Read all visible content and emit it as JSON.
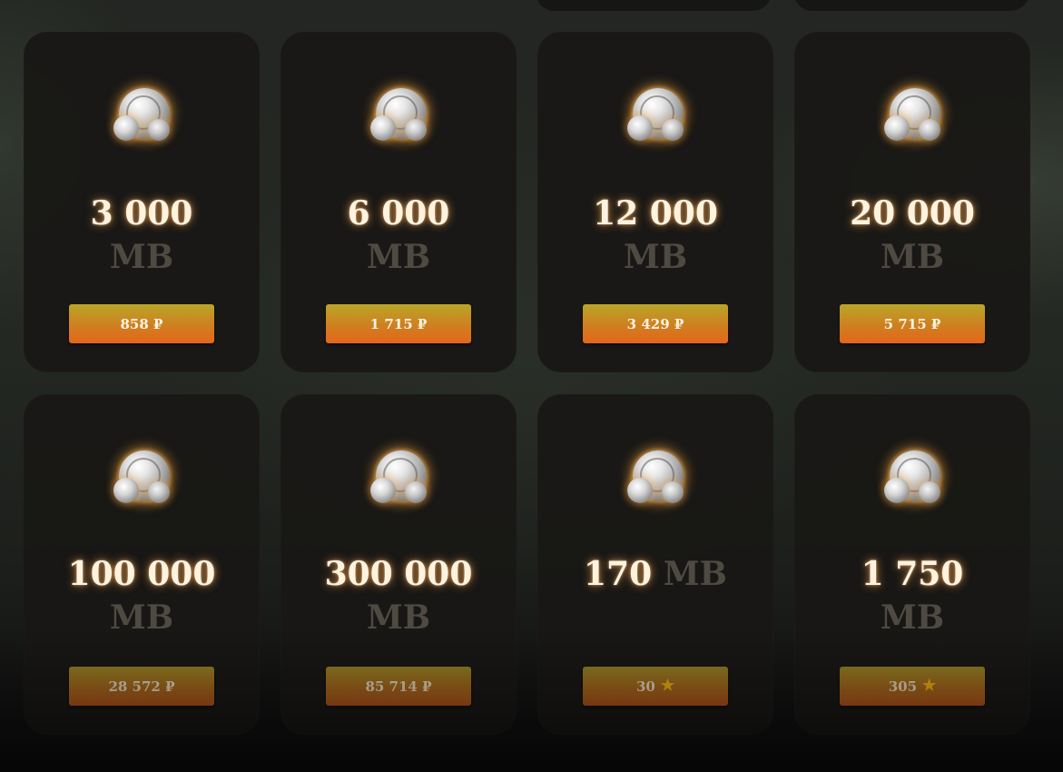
{
  "packages": [
    {
      "amount": "3 000",
      "unit": "MB",
      "price": "858 ₽",
      "star": false
    },
    {
      "amount": "6 000",
      "unit": "MB",
      "price": "1 715 ₽",
      "star": false
    },
    {
      "amount": "12 000",
      "unit": "MB",
      "price": "3 429 ₽",
      "star": false
    },
    {
      "amount": "20 000",
      "unit": "MB",
      "price": "5 715 ₽",
      "star": false
    },
    {
      "amount": "100 000",
      "unit": "MB",
      "price": "28 572 ₽",
      "star": false
    },
    {
      "amount": "300 000",
      "unit": "MB",
      "price": "85 714 ₽",
      "star": false
    },
    {
      "amount": "170",
      "unit": "MB",
      "price": "30",
      "star": true
    },
    {
      "amount": "1 750",
      "unit": "MB",
      "price": "305",
      "star": true
    }
  ],
  "icons": {
    "currency": "silver-coins-icon",
    "star": "star-icon"
  },
  "colors": {
    "button_top": "#b9a628",
    "button_bottom": "#e5661b",
    "amount_text": "#fff3e0",
    "unit_text": "#4e4a42",
    "star": "#e2a612"
  }
}
